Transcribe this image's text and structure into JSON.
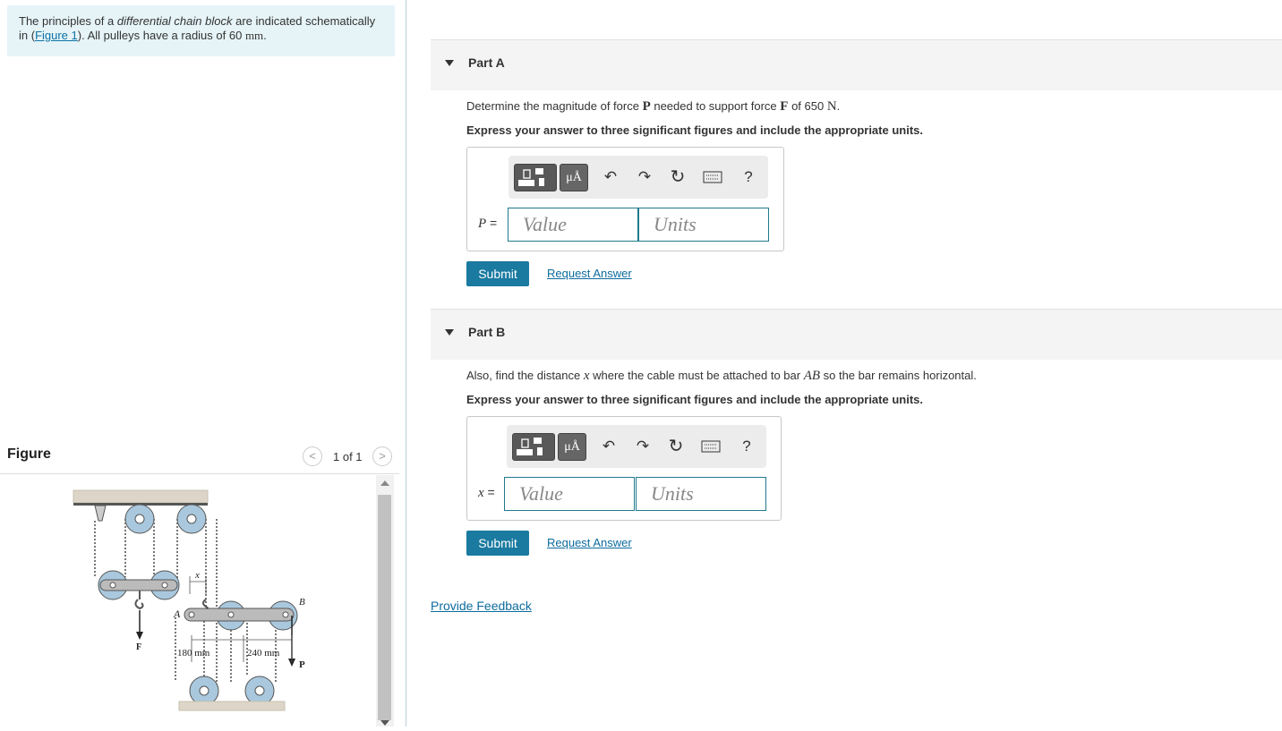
{
  "intro": {
    "text1": "The principles of a ",
    "text_italic": "differential chain block",
    "text2": " are indicated schematically in (",
    "figure_link": "Figure 1",
    "text3": "). All pulleys have a radius of 60 ",
    "unit": "mm",
    "text4": "."
  },
  "figure": {
    "title": "Figure",
    "pager": "1 of 1",
    "prev_icon": "chevron-left-icon",
    "next_icon": "chevron-right-icon",
    "labels": {
      "x": "x",
      "a": "A",
      "b": "B",
      "f": "F",
      "p": "P",
      "dim1": "180 mm",
      "dim2": "240 mm"
    }
  },
  "partA": {
    "title": "Part A",
    "q1": "Determine the magnitude of force ",
    "q_bold_var": "P",
    "q2": " needed to support force ",
    "q_bold_var2": "F",
    "q3": " of 650 ",
    "q_unit": "N",
    "q4": ".",
    "instruction": "Express your answer to three significant figures and include the appropriate units.",
    "var_label": "P",
    "equals": " =",
    "value_placeholder": "Value",
    "units_placeholder": "Units",
    "submit": "Submit",
    "request": "Request Answer"
  },
  "partB": {
    "title": "Part B",
    "q1": "Also, find the distance ",
    "q_var": "x",
    "q2": " where the cable must be attached to bar ",
    "q_var2": "AB",
    "q3": " so the bar remains horizontal.",
    "instruction": "Express your answer to three significant figures and include the appropriate units.",
    "var_label": "x",
    "equals": " =",
    "value_placeholder": "Value",
    "units_placeholder": "Units",
    "submit": "Submit",
    "request": "Request Answer"
  },
  "toolbar": {
    "mu_label": "μÅ",
    "help_label": "?",
    "icons": [
      "templates-icon",
      "units-mu-icon",
      "undo-icon",
      "redo-icon",
      "reset-icon",
      "keyboard-icon",
      "help-icon"
    ]
  },
  "feedback": "Provide Feedback",
  "colors": {
    "accent": "#1a7aa0",
    "intro_bg": "#e6f4f7",
    "link": "#0d6b9e",
    "pulley": "#a9c8dd"
  }
}
